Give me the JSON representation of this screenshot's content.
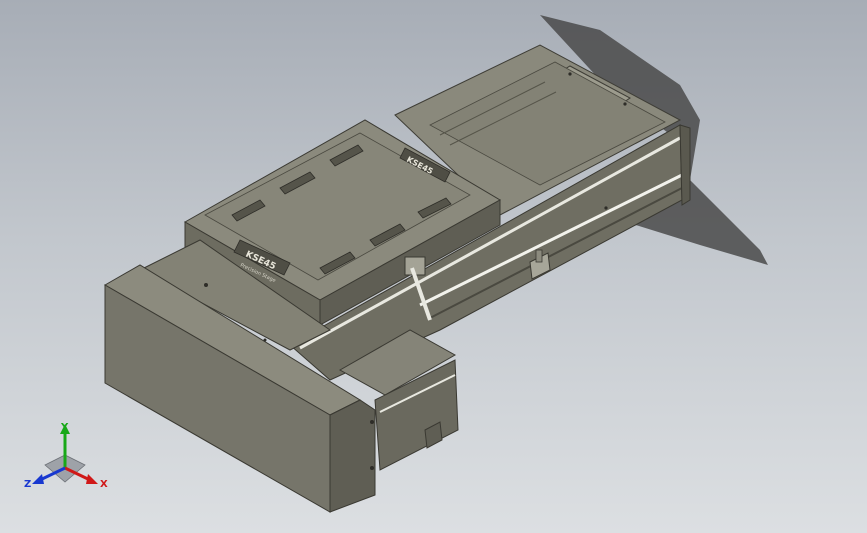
{
  "viewport": {
    "background_top": "#a7adb6",
    "background_bottom": "#dcdfe2",
    "model_color": "#7d7c6f",
    "model_light": "#9a9a8c",
    "model_dark": "#5f5e54",
    "shadow_color": "#3a3a3a"
  },
  "carriage": {
    "label_main": "KSE45",
    "label_sub": "Precision Stage"
  },
  "end_label": {
    "text": "KSE45"
  },
  "triad": {
    "x_label": "X",
    "y_label": "Y",
    "z_label": "Z",
    "x_color": "#d01818",
    "y_color": "#18a818",
    "z_color": "#1838d0",
    "icon": "coordinate-triad-icon"
  }
}
